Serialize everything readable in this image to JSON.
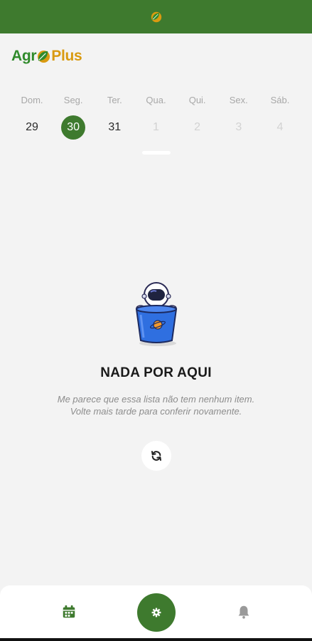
{
  "app": {
    "brand_left": "Agr",
    "brand_right": "Plus"
  },
  "icons": {
    "status": "agroplus-leaf-icon",
    "refresh": "refresh-icon",
    "nav_calendar": "calendar-icon",
    "nav_center": "gear-icon",
    "nav_bell": "bell-icon"
  },
  "week": {
    "days": [
      {
        "name": "Dom.",
        "num": "29"
      },
      {
        "name": "Seg.",
        "num": "30"
      },
      {
        "name": "Ter.",
        "num": "31"
      },
      {
        "name": "Qua.",
        "num": "1"
      },
      {
        "name": "Qui.",
        "num": "2"
      },
      {
        "name": "Sex.",
        "num": "3"
      },
      {
        "name": "Sáb.",
        "num": "4"
      }
    ]
  },
  "empty": {
    "title": "NADA POR AQUI",
    "line1": "Me parece que essa lista não tem nenhum item.",
    "line2": "Volte mais tarde para conferir novamente."
  },
  "colors": {
    "primary": "#3e7a2e",
    "brand_green": "#2f8a2b",
    "brand_gold": "#d99a11",
    "background": "#f3f3f3"
  }
}
